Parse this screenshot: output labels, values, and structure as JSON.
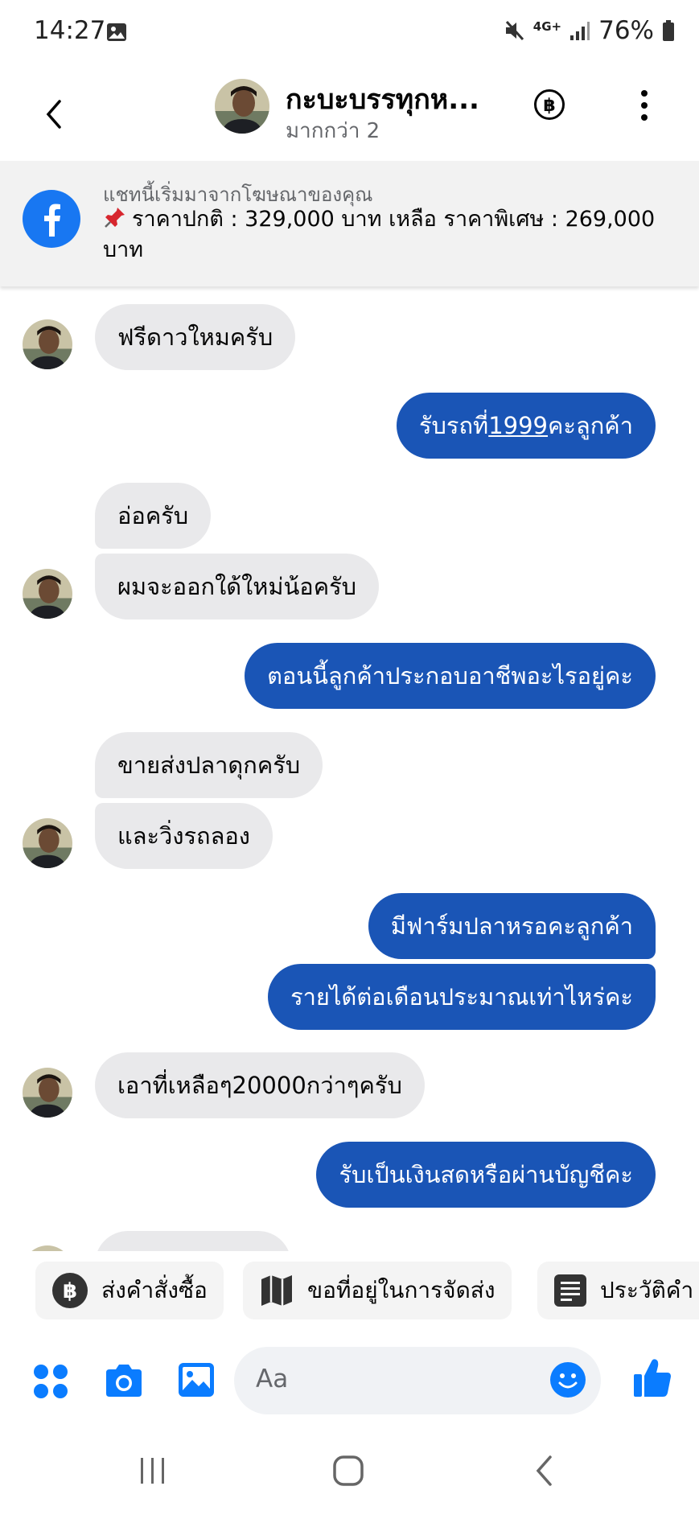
{
  "status_bar": {
    "time": "14:27",
    "network": "4G+",
    "battery": "76%"
  },
  "header": {
    "title": "กะบะบรรทุกห...",
    "subtitle": "มากกว่า 2"
  },
  "ad_banner": {
    "source": "แชทนี้เริ่มมาจากโฆษณาของคุณ",
    "text": "ราคาปกติ : 329,000 บาท เหลือ ราคาพิเศษ : 269,000 บาท"
  },
  "messages": [
    {
      "side": "in",
      "text": "ฟรีดาวใหมครับ"
    },
    {
      "side": "out",
      "text_before": "รับรถที่",
      "text_link": "1999",
      "text_after": "คะลูกค้า"
    },
    {
      "side": "in",
      "text": "อ่อครับ"
    },
    {
      "side": "in",
      "text": "ผมจะออกใด้ใหม่น้อครับ"
    },
    {
      "side": "out",
      "text": "ตอนนี้ลูกค้าประกอบอาชีพอะไรอยู่คะ"
    },
    {
      "side": "in",
      "text": "ขายส่งปลาดุกครับ"
    },
    {
      "side": "in",
      "text": "และวิ่งรถลอง"
    },
    {
      "side": "out",
      "text": "มีฟาร์มปลาหรอคะลูกค้า"
    },
    {
      "side": "out",
      "text": "รายได้ต่อเดือนประมาณเท่าไหร่คะ"
    },
    {
      "side": "in",
      "text": "เอาที่เหลือๆ20000กว่าๆครับ"
    },
    {
      "side": "out",
      "text": "รับเป็นเงินสดหรือผ่านบัญชีคะ"
    }
  ],
  "quick_replies": [
    {
      "label": "ส่งคำสั่งซื้อ",
      "icon": "baht-icon"
    },
    {
      "label": "ขอที่อยู่ในการจัดส่ง",
      "icon": "map-icon"
    },
    {
      "label": "ประวัติคำ",
      "icon": "receipt-icon"
    }
  ],
  "composer": {
    "placeholder": "Aa"
  },
  "colors": {
    "outgoing_bubble": "#1a55b6",
    "incoming_bubble": "#e9e9eb",
    "accent": "#0a7cff",
    "facebook": "#1877f2"
  }
}
